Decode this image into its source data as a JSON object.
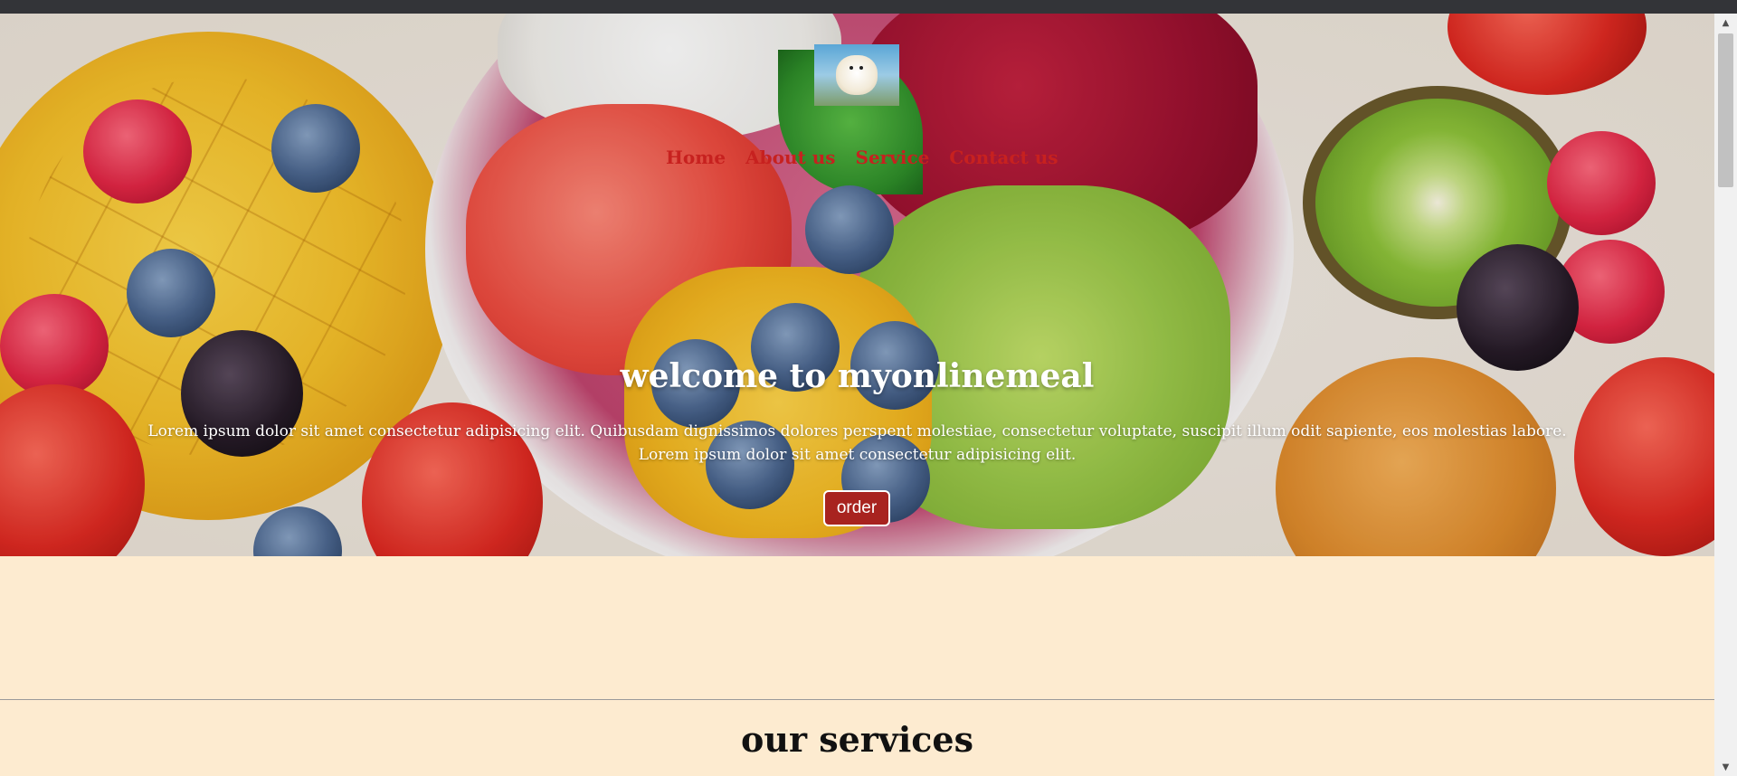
{
  "header": {
    "logo_alt": "puppy logo",
    "nav": [
      {
        "label": "Home"
      },
      {
        "label": "About us"
      },
      {
        "label": "Service"
      },
      {
        "label": "Contact us"
      }
    ]
  },
  "hero": {
    "title": "welcome to myonlinemeal",
    "text": "Lorem ipsum dolor sit amet consectetur adipisicing elit. Quibusdam dignissimos dolores perspent molestiae, consectetur voluptate, suscipit illum odit sapiente, eos molestias labore. Lorem ipsum dolor sit amet consectetur adipisicing elit.",
    "order_label": "order"
  },
  "services": {
    "title": "our services"
  },
  "icons": {
    "scroll_up": "scroll-up-arrow-icon",
    "scroll_down": "scroll-down-arrow-icon"
  },
  "colors": {
    "nav_link": "#c7211f",
    "order_button": "#a8231f",
    "page_background": "#fdebd0"
  }
}
